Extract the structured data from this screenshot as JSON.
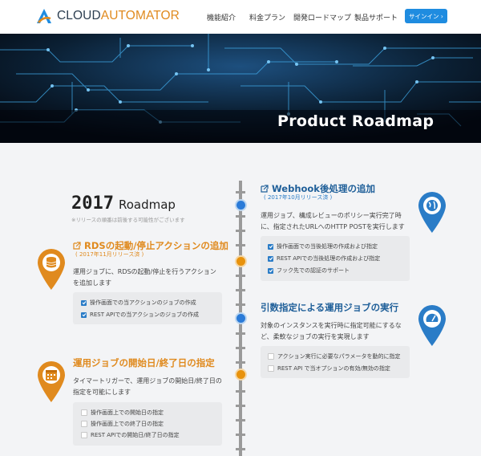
{
  "header": {
    "logo_part1": "CLOUD",
    "logo_part2": "AUTOMATOR",
    "nav": [
      "機能紹介",
      "料金プラン",
      "開発ロードマップ",
      "製品サポート"
    ],
    "signin": "サインイン ›"
  },
  "hero": {
    "title": "Product Roadmap"
  },
  "roadmap": {
    "year": "2017",
    "heading": "Roadmap",
    "note": "※リリースの順番は前後する可能性がございます",
    "features": [
      {
        "title": "Webhook後処理の追加",
        "release": "( 2017年10月リリース済 )",
        "description": "運用ジョブ、構成レビューのポリシー実行完了時に、指定されたURLへのHTTP POSTを実行します",
        "items": [
          "操作画面での当後処理の作成および指定",
          "REST APIでの当後処理の作成および指定",
          "フック先での認証のサポート"
        ],
        "checked": [
          true,
          true,
          true
        ]
      },
      {
        "title": "RDSの起動/停止アクションの追加",
        "release": "( 2017年11月リリース済 )",
        "description": "運用ジョブに、RDSの起動/停止を行うアクションを追加します",
        "items": [
          "操作画面での当アクションのジョブの作成",
          "REST APIでの当アクションのジョブの作成"
        ],
        "checked": [
          true,
          true
        ]
      },
      {
        "title": "引数指定による運用ジョブの実行",
        "release": "",
        "description": "対象のインスタンスを実行時に指定可能にするなど、柔軟なジョブの実行を実現します",
        "items": [
          "アクション実行に必要なパラメータを動的に指定",
          "REST API で当オプションの有効/無効の指定"
        ],
        "checked": [
          false,
          false
        ]
      },
      {
        "title": "運用ジョブの開始日/終了日の指定",
        "release": "",
        "description": "タイマートリガーで、運用ジョブの開始日/終了日の指定を可能にします",
        "items": [
          "操作画面上での開始日の指定",
          "操作画面上での終了日の指定",
          "REST APIでの開始日/終了日の指定"
        ],
        "checked": [
          false,
          false,
          false
        ]
      }
    ]
  },
  "colors": {
    "accent_orange": "#e08a1e",
    "accent_blue": "#2a7cc7",
    "signin_bg": "#1f8ce0"
  },
  "icons": [
    "external-link-icon",
    "globe-icon",
    "database-icon",
    "speedometer-icon",
    "calendar-icon",
    "checkbox-icon"
  ]
}
